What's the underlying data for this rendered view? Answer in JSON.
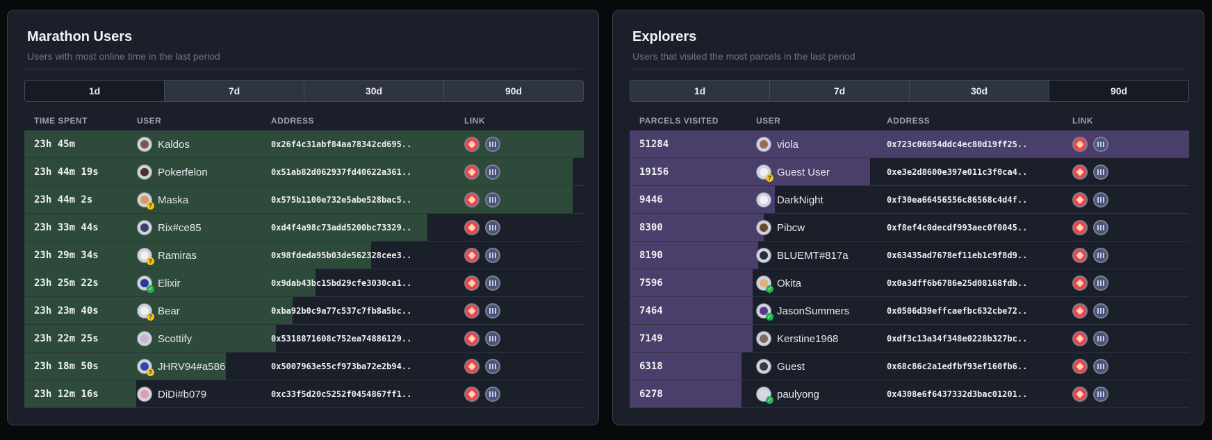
{
  "colors": {
    "green_bar": "#2e4a3a",
    "purple_bar": "#4a3f6b",
    "dcl_red": "#e8464c"
  },
  "panels": [
    {
      "title": "Marathon Users",
      "subtitle": "Users with most online time in the last period",
      "tabs": [
        "1d",
        "7d",
        "30d",
        "90d"
      ],
      "active_tab": 0,
      "columns": {
        "metric": "TIME SPENT",
        "user": "USER",
        "address": "ADDRESS",
        "link": "LINK"
      },
      "bar_color": "#2e4a3a",
      "rows": [
        {
          "metric": "23h 45m",
          "user": "Kaldos",
          "address": "0x26f4c31abf84aa78342cd695..",
          "share": 1.0,
          "badge": "none",
          "avatar": "#7a5a45"
        },
        {
          "metric": "23h 44m 19s",
          "user": "Pokerfelon",
          "address": "0x51ab82d062937fd40622a361..",
          "share": 0.98,
          "badge": "none",
          "avatar": "#4a3428"
        },
        {
          "metric": "23h 44m 2s",
          "user": "Maska",
          "address": "0x575b1100e732e5abe528bac5..",
          "share": 0.98,
          "badge": "unknown",
          "avatar": "#d79a63"
        },
        {
          "metric": "23h 33m 44s",
          "user": "Rix#ce85",
          "address": "0xd4f4a98c73add5200bc73329..",
          "share": 0.72,
          "badge": "none",
          "avatar": "#3b3f6a"
        },
        {
          "metric": "23h 29m 34s",
          "user": "Ramiras",
          "address": "0x98fdeda95b03de562328cee3..",
          "share": 0.62,
          "badge": "unknown",
          "avatar": "#eef0f4"
        },
        {
          "metric": "23h 25m 22s",
          "user": "Elixir",
          "address": "0x9dab43bc15bd29cfe3030ca1..",
          "share": 0.52,
          "badge": "verified",
          "avatar": "#2b3a9a"
        },
        {
          "metric": "23h 23m 40s",
          "user": "Bear",
          "address": "0xba92b0c9a77c537c7fb8a5bc..",
          "share": 0.48,
          "badge": "unknown",
          "avatar": "#eef0f4"
        },
        {
          "metric": "23h 22m 25s",
          "user": "Scottify",
          "address": "0x5318871608c752ea74886129..",
          "share": 0.45,
          "badge": "none",
          "avatar": "#c9b3d6"
        },
        {
          "metric": "23h 18m 50s",
          "user": "JHRV94#a586",
          "address": "0x5007963e55cf973ba72e2b94..",
          "share": 0.36,
          "badge": "unknown",
          "avatar": "#3146b5"
        },
        {
          "metric": "23h 12m 16s",
          "user": "DiDi#b079",
          "address": "0xc33f5d20c5252f0454867ff1..",
          "share": 0.2,
          "badge": "none",
          "avatar": "#e59aa8"
        }
      ]
    },
    {
      "title": "Explorers",
      "subtitle": "Users that visited the most parcels in the last period",
      "tabs": [
        "1d",
        "7d",
        "30d",
        "90d"
      ],
      "active_tab": 3,
      "columns": {
        "metric": "PARCELS VISITED",
        "user": "USER",
        "address": "ADDRESS",
        "link": "LINK"
      },
      "bar_color": "#4a3f6b",
      "rows": [
        {
          "metric": "51284",
          "user": "viola",
          "address": "0x723c06054ddc4ec80d19ff25..",
          "share": 1.0,
          "badge": "none",
          "avatar": "#9a6a55"
        },
        {
          "metric": "19156",
          "user": "Guest User",
          "address": "0xe3e2d8600e397e011c3f0ca4..",
          "share": 0.43,
          "badge": "unknown",
          "avatar": "#eef0f4"
        },
        {
          "metric": "9446",
          "user": "DarkNight",
          "address": "0xf30ea66456556c86568c4d4f..",
          "share": 0.26,
          "badge": "none",
          "avatar": "#f3f0f8"
        },
        {
          "metric": "8300",
          "user": "Pibcw",
          "address": "0xf8ef4c0decdf993aec0f0045..",
          "share": 0.24,
          "badge": "none",
          "avatar": "#6a4a2a"
        },
        {
          "metric": "8190",
          "user": "BLUEMT#817a",
          "address": "0x63435ad7678ef11eb1c9f8d9..",
          "share": 0.23,
          "badge": "none",
          "avatar": "#2a2a3a"
        },
        {
          "metric": "7596",
          "user": "Okita",
          "address": "0x0a3dff6b6786e25d08168fdb..",
          "share": 0.22,
          "badge": "verified",
          "avatar": "#e3b07a"
        },
        {
          "metric": "7464",
          "user": "JasonSummers",
          "address": "0x0506d39effcaefbc632cbe72..",
          "share": 0.22,
          "badge": "verified",
          "avatar": "#5a3a8a"
        },
        {
          "metric": "7149",
          "user": "Kerstine1968",
          "address": "0xdf3c13a34f348e0228b327bc..",
          "share": 0.22,
          "badge": "none",
          "avatar": "#7a6a60"
        },
        {
          "metric": "6318",
          "user": "Guest",
          "address": "0x68c86c2a1edfbf93ef160fb6..",
          "share": 0.2,
          "badge": "none",
          "avatar": "#3a3a3a"
        },
        {
          "metric": "6278",
          "user": "paulyong",
          "address": "0x4308e6f6437332d3bac01201..",
          "share": 0.2,
          "badge": "verified",
          "avatar": "#d8d8e0"
        }
      ]
    }
  ]
}
